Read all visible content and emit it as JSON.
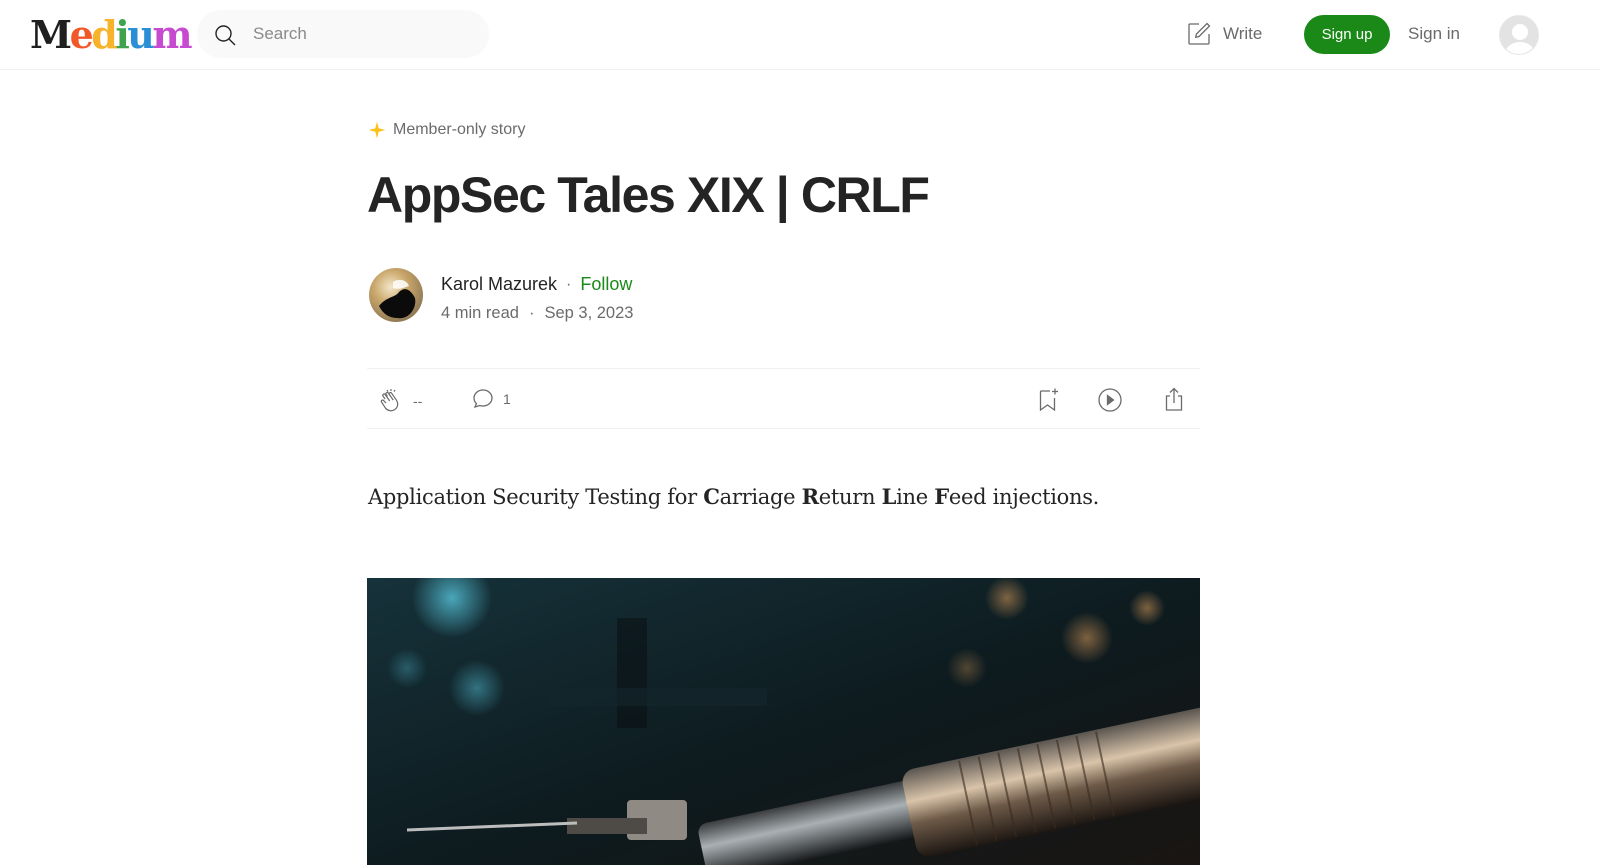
{
  "header": {
    "logo_text": "Medium",
    "search": {
      "placeholder": "Search"
    },
    "write_label": "Write",
    "signup_label": "Sign up",
    "signin_label": "Sign in"
  },
  "article": {
    "member_badge": "Member-only story",
    "title": "AppSec Tales XIX | CRLF",
    "author": {
      "name": "Karol Mazurek",
      "follow_label": "Follow",
      "separator": "·"
    },
    "meta": {
      "read_time": "4 min read",
      "separator": "·",
      "date": "Sep 3, 2023"
    },
    "actions": {
      "claps": "--",
      "responses": "1"
    },
    "subtitle": {
      "parts": [
        "Application Security Testing for ",
        "C",
        "arriage ",
        "R",
        "eturn ",
        "L",
        "ine ",
        "F",
        "eed injections."
      ]
    }
  },
  "colors": {
    "accent_green": "#1a8917",
    "star_yellow": "#ffc017",
    "muted_text": "#6b6b6b"
  },
  "icons": {
    "search": "search-icon",
    "write": "write-icon",
    "user": "user-avatar-icon",
    "star": "star-icon",
    "clap": "clap-icon",
    "response": "response-icon",
    "bookmark": "bookmark-add-icon",
    "listen": "play-icon",
    "share": "share-icon"
  }
}
